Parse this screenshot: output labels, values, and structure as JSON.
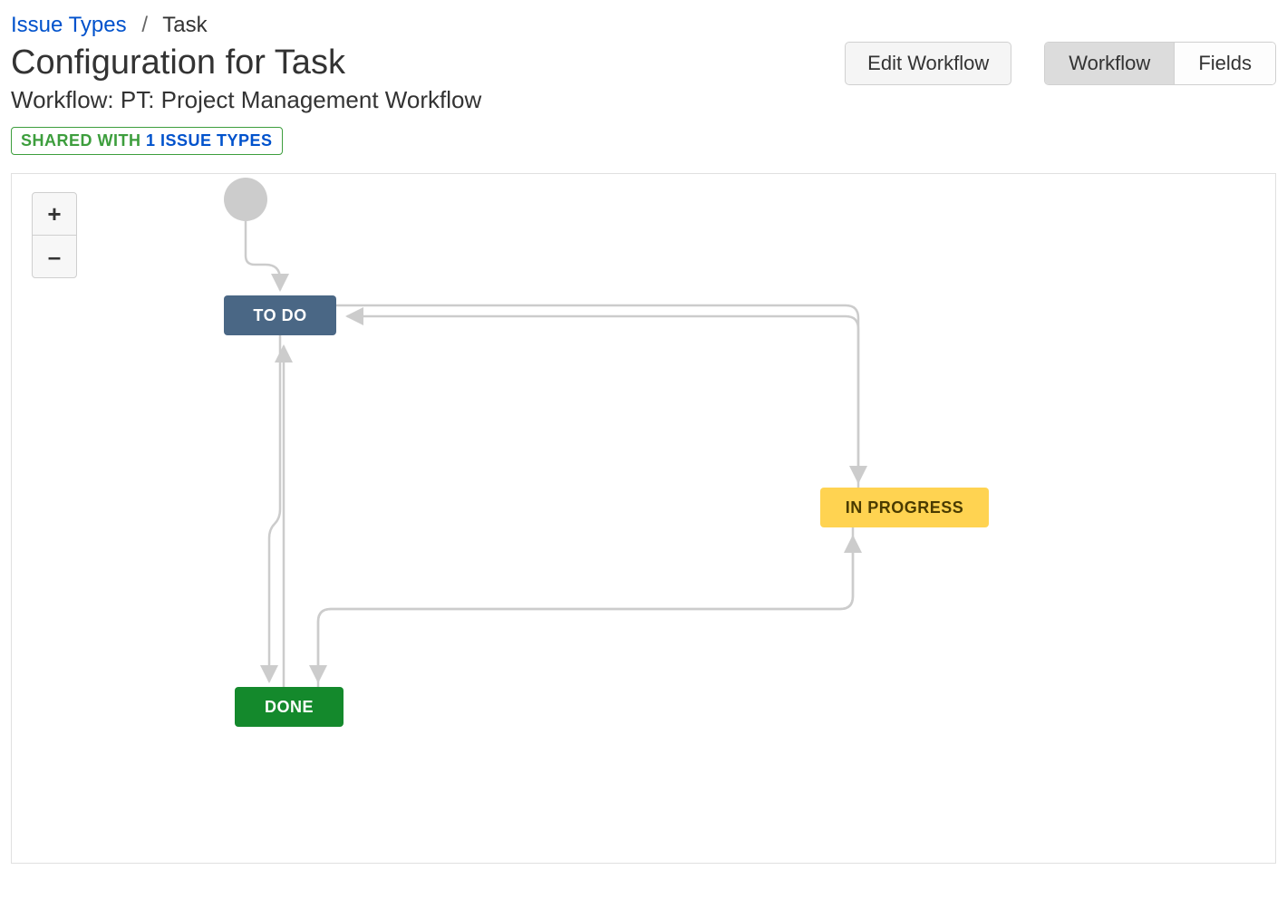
{
  "breadcrumb": {
    "root_label": "Issue Types",
    "current": "Task"
  },
  "title": "Configuration for Task",
  "workflow_line_prefix": "Workflow: ",
  "workflow_name": "PT: Project Management Workflow",
  "shared_badge": {
    "prefix": "SHARED WITH ",
    "count_text": "1 ISSUE TYPES"
  },
  "actions": {
    "edit_workflow": "Edit Workflow"
  },
  "tabs": {
    "workflow": "Workflow",
    "fields": "Fields"
  },
  "zoom": {
    "in": "+",
    "out": "–"
  },
  "workflow_diagram": {
    "statuses": {
      "todo": "TO DO",
      "in_progress": "IN PROGRESS",
      "done": "DONE"
    },
    "transitions": [
      {
        "from": "start",
        "to": "todo"
      },
      {
        "from": "todo",
        "to": "in_progress"
      },
      {
        "from": "in_progress",
        "to": "todo"
      },
      {
        "from": "todo",
        "to": "done"
      },
      {
        "from": "in_progress",
        "to": "done"
      },
      {
        "from": "done",
        "to": "in_progress"
      },
      {
        "from": "done",
        "to": "todo"
      }
    ]
  }
}
